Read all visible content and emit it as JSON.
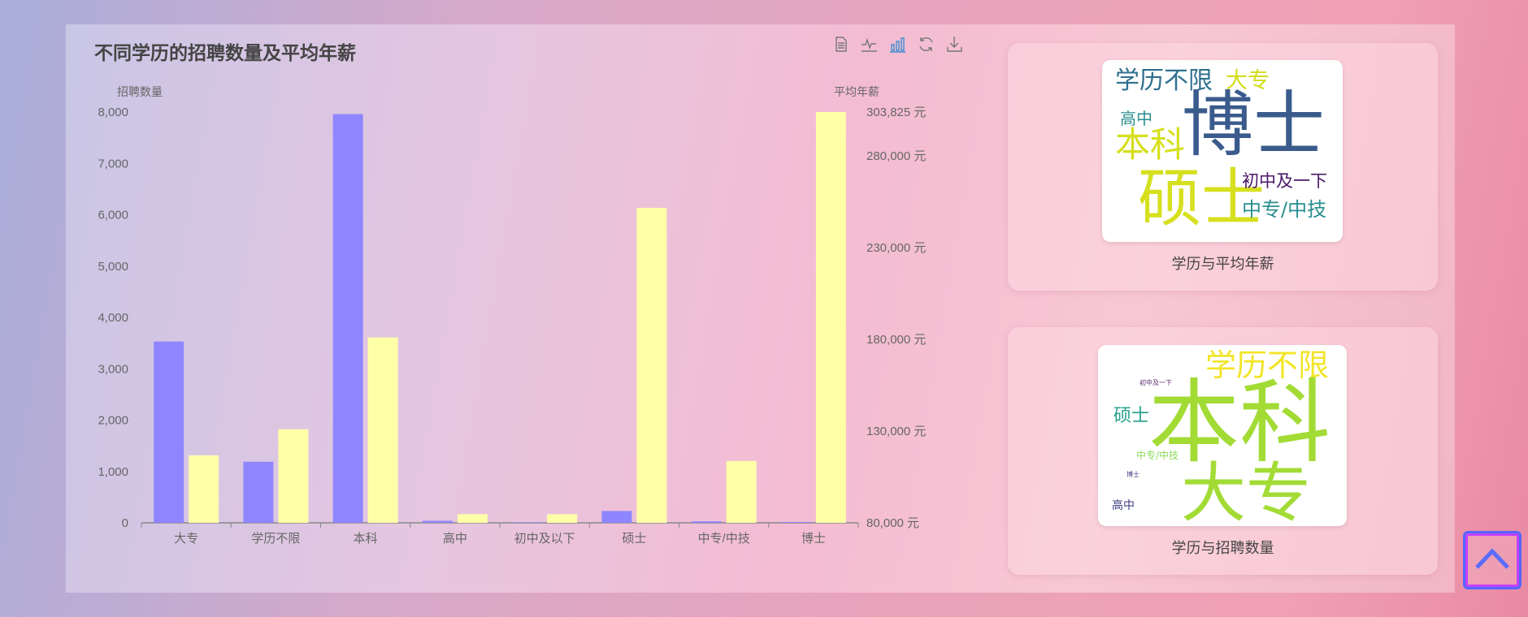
{
  "chart_data": {
    "type": "bar",
    "title": "不同学历的招聘数量及平均年薪",
    "categories": [
      "大专",
      "学历不限",
      "本科",
      "高中",
      "初中及以下",
      "硕士",
      "中专/中技",
      "博士"
    ],
    "series": [
      {
        "name": "招聘数量",
        "axis": "left",
        "color": "#8f86ff",
        "values": [
          3530,
          1190,
          7960,
          40,
          10,
          230,
          30,
          15
        ]
      },
      {
        "name": "平均年薪",
        "axis": "right",
        "color": "#ffffa8",
        "values": [
          116800,
          131000,
          181000,
          84700,
          84700,
          251600,
          113700,
          303825
        ]
      }
    ],
    "y_left": {
      "name": "招聘数量",
      "range": [
        0,
        8000
      ],
      "ticks": [
        "0",
        "1,000",
        "2,000",
        "3,000",
        "4,000",
        "5,000",
        "6,000",
        "7,000",
        "8,000"
      ]
    },
    "y_right": {
      "name": "平均年薪",
      "range": [
        80000,
        303825
      ],
      "tick_values": [
        80000,
        130000,
        180000,
        230000,
        280000,
        303825
      ],
      "ticks": [
        "80,000 元",
        "130,000 元",
        "180,000 元",
        "230,000 元",
        "280,000 元",
        "303,825 元"
      ]
    }
  },
  "toolbar": [
    "data-view-icon",
    "line-chart-icon",
    "bar-chart-icon",
    "restore-icon",
    "download-icon"
  ],
  "cards": [
    {
      "caption": "学历与平均年薪",
      "words": [
        "学历不限",
        "大专",
        "高中",
        "博士",
        "本科",
        "硕士",
        "初中及一下",
        "中专/中技"
      ]
    },
    {
      "caption": "学历与招聘数量",
      "words": [
        "学历不限",
        "初中及一下",
        "本科",
        "硕士",
        "中专/中技",
        "博士",
        "高中",
        "大专"
      ]
    }
  ]
}
